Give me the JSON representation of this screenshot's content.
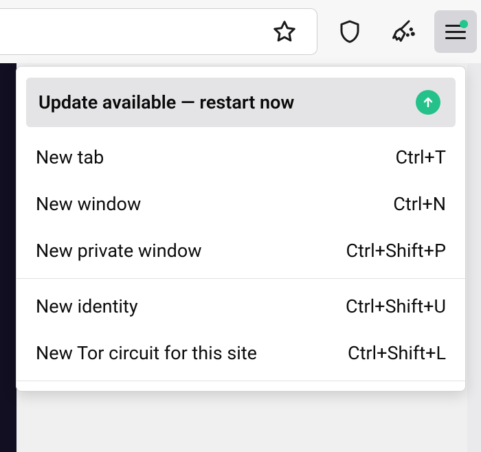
{
  "menu": {
    "update": {
      "label": "Update available — restart now"
    },
    "groups": [
      [
        {
          "id": "new-tab",
          "label": "New tab",
          "shortcut": "Ctrl+T"
        },
        {
          "id": "new-window",
          "label": "New window",
          "shortcut": "Ctrl+N"
        },
        {
          "id": "new-private-window",
          "label": "New private window",
          "shortcut": "Ctrl+Shift+P"
        }
      ],
      [
        {
          "id": "new-identity",
          "label": "New identity",
          "shortcut": "Ctrl+Shift+U"
        },
        {
          "id": "new-tor-circuit",
          "label": "New Tor circuit for this site",
          "shortcut": "Ctrl+Shift+L"
        }
      ]
    ]
  }
}
